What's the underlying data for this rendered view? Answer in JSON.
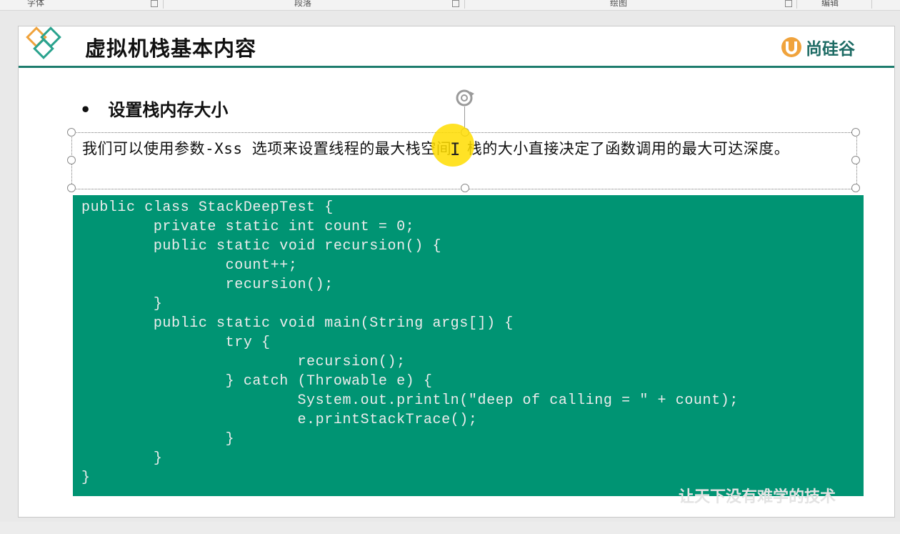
{
  "ribbon": {
    "groups": [
      "字体",
      "段落",
      "绘图",
      "编辑"
    ]
  },
  "slide": {
    "title": "虚拟机栈基本内容",
    "brand": "尚硅谷",
    "bullet": "设置栈内存大小",
    "textbox": "我们可以使用参数-Xss 选项来设置线程的最大栈空间，栈的大小直接决定了函数调用的最大可达深度。",
    "code_lines": [
      "public class StackDeepTest {",
      "        private static int count = 0;",
      "        public static void recursion() {",
      "                count++;",
      "                recursion();",
      "        }",
      "        public static void main(String args[]) {",
      "                try {",
      "                        recursion();",
      "                } catch (Throwable e) {",
      "                        System.out.println(\"deep of calling = \" + count);",
      "                        e.printStackTrace();",
      "                }",
      "        }",
      "}"
    ],
    "watermark": "让天下没有难学的技术"
  },
  "colors": {
    "code_bg": "#009473",
    "accent": "#1d7c6d",
    "brand": "#1d6b64",
    "cursor_highlight": "#ffdd00",
    "logo_orange": "#f0a33c",
    "logo_teal": "#2aa38e"
  },
  "icons": [
    "logo-diamonds-icon",
    "brand-u-icon",
    "rotate-handle-icon",
    "text-cursor-icon"
  ]
}
